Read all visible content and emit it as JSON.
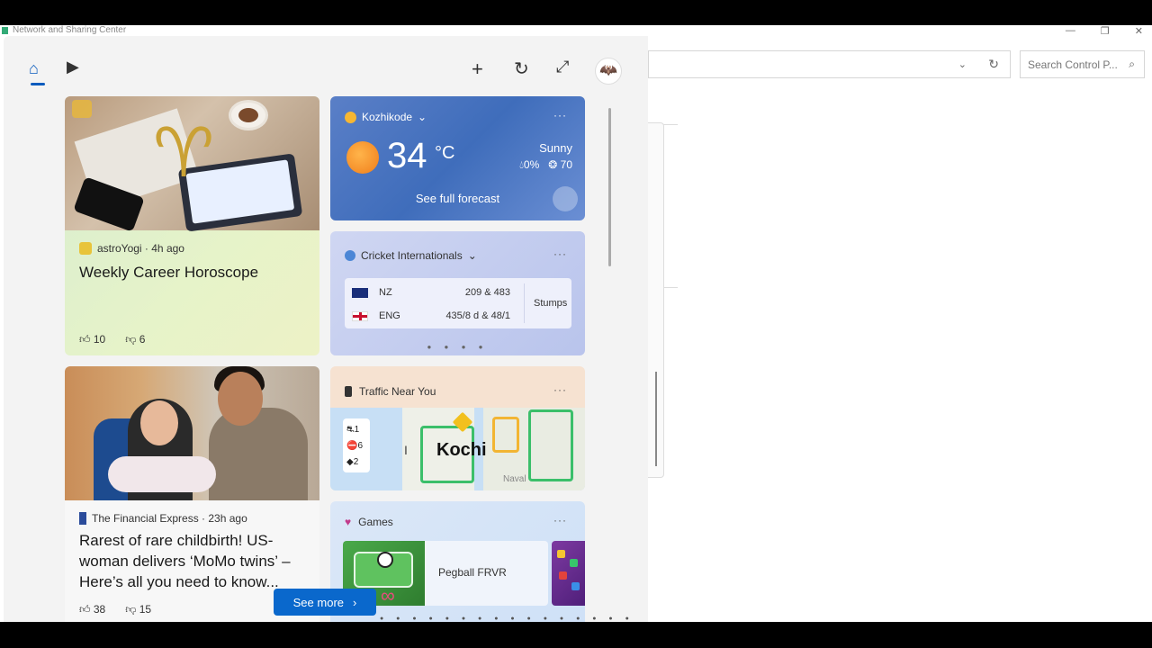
{
  "background_window": {
    "title": "Network and Sharing Center",
    "search_placeholder": "Search Control P...",
    "win_controls": [
      "—",
      "❐",
      "✕"
    ]
  },
  "panel": {
    "nav_icons": [
      "home-icon",
      "video-icon",
      "add-icon",
      "refresh-icon",
      "expand-icon",
      "avatar"
    ]
  },
  "horoscope": {
    "source": "astroYogi · 4h ago",
    "headline": "Weekly Career Horoscope",
    "likes": "10",
    "dislikes": "6"
  },
  "weather": {
    "location": "Kozhikode",
    "temperature": "34",
    "unit": "°C",
    "condition": "Sunny",
    "precip": "0%",
    "aqi": "70",
    "forecast_link": "See full forecast",
    "more": "···"
  },
  "cricket": {
    "title": "Cricket Internationals",
    "teams": [
      {
        "name": "NZ",
        "score": "209 & 483"
      },
      {
        "name": "ENG",
        "score": "435/8 d & 48/1"
      }
    ],
    "status": "Stumps",
    "more": "···"
  },
  "traffic": {
    "title": "Traffic Near You",
    "city": "Kochi",
    "area": "Naval",
    "legend": [
      {
        "icon": "⛐",
        "count": "1"
      },
      {
        "icon": "⛔",
        "count": "6"
      },
      {
        "icon": "◆",
        "count": "2"
      }
    ],
    "more": "···"
  },
  "news": {
    "source": "The Financial Express · 23h ago",
    "headline": "Rarest of rare childbirth! US-woman delivers ‘MoMo twins’ – Here’s all you need to know...",
    "likes": "38",
    "dislikes": "15"
  },
  "games": {
    "title": "Games",
    "game_name": "Pegball FRVR",
    "more": "···"
  },
  "see_more": "See more",
  "colors": {
    "accent": "#0a68cc",
    "weather_bg": "#4a74c0",
    "cricket_bg": "#c3cdf0",
    "traffic_bg": "#f6e2d1",
    "horoscope_bg": "#dcefcd"
  }
}
